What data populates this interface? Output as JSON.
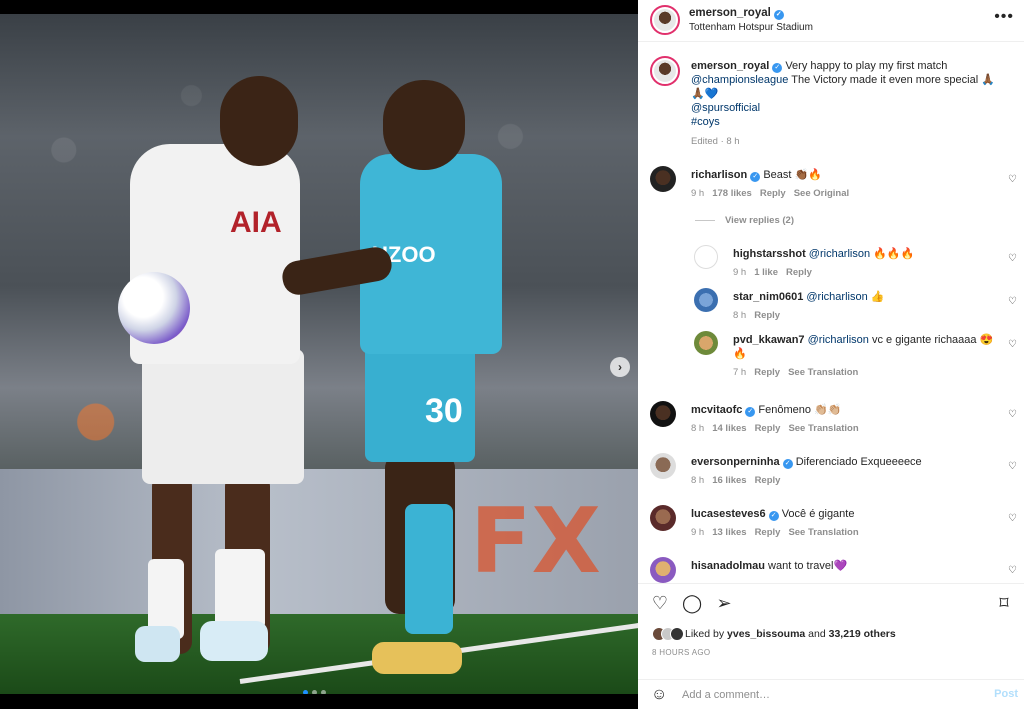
{
  "header": {
    "username": "emerson_royal",
    "location": "Tottenham Hotspur Stadium",
    "more_icon": "more-horizontal-icon"
  },
  "photo": {
    "shirt_text": "AIA",
    "away_shirt_text": "UZOO",
    "away_number": "30",
    "next_icon": "chevron-right-icon",
    "carousel_dots": 3,
    "active_dot": 1
  },
  "caption": {
    "username": "emerson_royal",
    "line1": " Very happy to play my first match",
    "mention1": "@championsleague",
    "line2": " The Victory made it even more special 🙏🏾🙏🏾💙",
    "mention2": "@spursofficial",
    "hashtag": "#coys",
    "meta": "Edited · 8 h"
  },
  "comments": [
    {
      "username": "richarlison",
      "verified": true,
      "text": "Beast 👏🏾🔥",
      "time": "9 h",
      "likes": "178 likes",
      "reply": "Reply",
      "extra": "See Original"
    },
    {
      "username": "mcvitaofc",
      "verified": true,
      "text": "Fenômeno 👏🏼👏🏼",
      "time": "8 h",
      "likes": "14 likes",
      "reply": "Reply",
      "extra": "See Translation"
    },
    {
      "username": "eversonperninha",
      "verified": true,
      "text": "Diferenciado Exqueeeece",
      "time": "8 h",
      "likes": "16 likes",
      "reply": "Reply",
      "extra": ""
    },
    {
      "username": "lucasesteves6",
      "verified": true,
      "text": "Você é gigante",
      "time": "9 h",
      "likes": "13 likes",
      "reply": "Reply",
      "extra": "See Translation"
    },
    {
      "username": "hisanadolmau",
      "verified": false,
      "text": "want to travel💜"
    }
  ],
  "replies": {
    "toggle": "View replies (2)",
    "items": [
      {
        "username": "highstarsshot",
        "mention": "@richarlison",
        "text": " 🔥🔥🔥",
        "time": "9 h",
        "likes": "1 like",
        "reply": "Reply",
        "extra": ""
      },
      {
        "username": "star_nim0601",
        "mention": "@richarlison",
        "text": " 👍",
        "time": "8 h",
        "likes": "",
        "reply": "Reply",
        "extra": ""
      },
      {
        "username": "pvd_kkawan7",
        "mention": "@richarlison",
        "text": " vc e gigante richaaaa 😍🔥",
        "time": "7 h",
        "likes": "",
        "reply": "Reply",
        "extra": "See Translation"
      }
    ]
  },
  "actions": {
    "like_icon": "heart-icon",
    "comment_icon": "comment-icon",
    "share_icon": "send-icon",
    "save_icon": "bookmark-icon",
    "liked_prefix": "Liked by ",
    "liked_user": "yves_bissouma",
    "liked_mid": " and ",
    "liked_count": "33,219 others",
    "timestamp": "8 HOURS AGO"
  },
  "comment_box": {
    "emoji_icon": "smiley-icon",
    "placeholder": "Add a comment…",
    "post_label": "Post"
  },
  "colors": {
    "link": "#00376b",
    "verified": "#3897f0",
    "muted": "#8e8e8e",
    "post_disabled": "#b2dffc"
  }
}
